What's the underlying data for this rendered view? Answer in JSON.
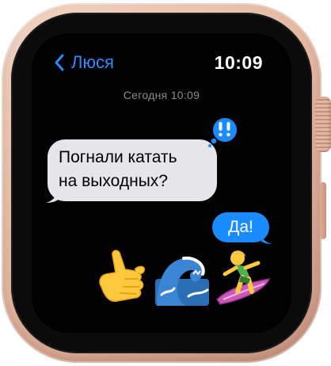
{
  "header": {
    "back_label": "Люся",
    "time": "10:09"
  },
  "conversation": {
    "date_label": "Сегодня 10:09",
    "incoming_message": {
      "line1": "Погнали катать",
      "line2": "на выходных?",
      "tapback": "emphasis-exclamation-icon"
    },
    "outgoing_message": "Да!",
    "emoji_reply": [
      "call-me-hand-emoji",
      "water-wave-emoji",
      "surfer-emoji"
    ]
  },
  "colors": {
    "accent_blue": "#1a8cff",
    "incoming_bubble": "#e5e5ea",
    "case_rose_gold": "#e7bfa9"
  }
}
